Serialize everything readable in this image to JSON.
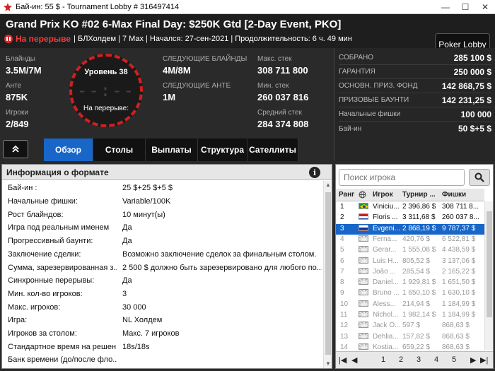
{
  "window": {
    "title": "Бай-ин: 55 $ - Tournament Lobby # 316497414"
  },
  "header": {
    "tournament_title": "Grand Prix KO #02 6-Max Final Day: $250K Gtd [2-Day Event, PKO]",
    "status": "На перерыве",
    "details": "| БЛХолдем | 7 Max | Начался: 27-сен-2021 | Продолжительность: 6 ч. 49 мин",
    "lobby_button": "Poker Lobby"
  },
  "info": {
    "blinds_label": "Блайнды",
    "blinds_value": "3.5M/7M",
    "ante_label": "Анте",
    "ante_value": "875K",
    "players_label": "Игроки",
    "players_value": "2/849",
    "level_label": "Уровень 38",
    "clock_value": "--:--",
    "break_label": "На перерыве:",
    "next_blinds_label": "СЛЕДУЮЩИЕ БЛАЙНДЫ",
    "next_blinds_value": "4M/8M",
    "next_ante_label": "СЛЕДУЮЩИЕ АНТЕ",
    "next_ante_value": "1M",
    "max_stack_label": "Макс. стек",
    "max_stack_value": "308 711 800",
    "min_stack_label": "Мин. стек",
    "min_stack_value": "260 037 816",
    "avg_stack_label": "Средний стек",
    "avg_stack_value": "284 374 808"
  },
  "stats": [
    {
      "label": "СОБРАНО",
      "value": "285 100 $"
    },
    {
      "label": "ГАРАНТИЯ",
      "value": "250 000 $"
    },
    {
      "label": "ОСНОВН. ПРИЗ. ФОНД",
      "value": "142 868,75 $"
    },
    {
      "label": "ПРИЗОВЫЕ БАУНТИ",
      "value": "142 231,25 $"
    },
    {
      "label": "Начальные фишки",
      "value": "100 000"
    },
    {
      "label": "Бай-ин",
      "value": "50 $+5 $"
    }
  ],
  "tabs": [
    "Обзор",
    "Столы",
    "Выплаты",
    "Структура",
    "Сателлиты"
  ],
  "format_panel": {
    "title": "Информация о формате",
    "rows": [
      {
        "k": "Бай-ин :",
        "v": "25 $+25 $+5 $"
      },
      {
        "k": "Начальные фишки:",
        "v": "Variable/100K"
      },
      {
        "k": "Рост блайндов:",
        "v": "10 минут(ы)"
      },
      {
        "k": "Игра под реальным именем",
        "v": "Да"
      },
      {
        "k": "Прогрессивный баунти:",
        "v": "Да"
      },
      {
        "k": "Заключение сделки:",
        "v": "Возможно заключение сделок за финальным столом."
      },
      {
        "k": "Сумма, зарезервированная з...",
        "v": "2 500 $ должно быть зарезервировано для любого по..."
      },
      {
        "k": "Синхронные перерывы:",
        "v": "Да"
      },
      {
        "k": "Мин. кол-во игроков:",
        "v": "3"
      },
      {
        "k": "Макс. игроков:",
        "v": "30 000"
      },
      {
        "k": "Игра:",
        "v": "NL Холдем"
      },
      {
        "k": "Игроков за столом:",
        "v": "Макс. 7 игроков"
      },
      {
        "k": "Стандартное время на решен...",
        "v": "18s/18s"
      },
      {
        "k": "Банк времени (до/после фло...",
        "v": ""
      }
    ]
  },
  "players_panel": {
    "search_placeholder": "Поиск игрока",
    "columns": {
      "rank": "Ранг",
      "name": "Игрок",
      "tour": "Турнир ...",
      "chips": "Фишки"
    },
    "rows": [
      {
        "rank": "1",
        "name": "Viniciu...",
        "tour": "2 396,86 $",
        "chips": "308 711 8...",
        "flag": "br",
        "state": "top"
      },
      {
        "rank": "2",
        "name": "Floris ...",
        "tour": "3 311,68 $",
        "chips": "260 037 8...",
        "flag": "nl",
        "state": "top"
      },
      {
        "rank": "3",
        "name": "Evgeni...",
        "tour": "2 868,19 $",
        "chips": "9 787,37 $",
        "flag": "ru",
        "state": "sel"
      },
      {
        "rank": "4",
        "name": "Ferna...",
        "tour": "420,76 $",
        "chips": "6 522,81 $",
        "flag": "gb",
        "state": "dim"
      },
      {
        "rank": "5",
        "name": "Gerar...",
        "tour": "1 555,08 $",
        "chips": "4 438,59 $",
        "flag": "gb",
        "state": "dim"
      },
      {
        "rank": "6",
        "name": "Luis H...",
        "tour": "805,52 $",
        "chips": "3 137,06 $",
        "flag": "gb",
        "state": "dim"
      },
      {
        "rank": "7",
        "name": "João ...",
        "tour": "285,54 $",
        "chips": "2 165,22 $",
        "flag": "gb",
        "state": "dim"
      },
      {
        "rank": "8",
        "name": "Daniel...",
        "tour": "1 929,81 $",
        "chips": "1 651,50 $",
        "flag": "gb",
        "state": "dim"
      },
      {
        "rank": "9",
        "name": "Bruno ...",
        "tour": "1 650,10 $",
        "chips": "1 630,10 $",
        "flag": "gb",
        "state": "dim"
      },
      {
        "rank": "10",
        "name": "Aless...",
        "tour": "214,94 $",
        "chips": "1 184,99 $",
        "flag": "gb",
        "state": "dim"
      },
      {
        "rank": "11",
        "name": "Nichol...",
        "tour": "1 982,14 $",
        "chips": "1 184,99 $",
        "flag": "gb",
        "state": "dim"
      },
      {
        "rank": "12",
        "name": "Jack O...",
        "tour": "597 $",
        "chips": "868,63 $",
        "flag": "gb",
        "state": "dim"
      },
      {
        "rank": "13",
        "name": "Dehlia...",
        "tour": "157,82 $",
        "chips": "868,63 $",
        "flag": "gb",
        "state": "dim"
      },
      {
        "rank": "14",
        "name": "Kostia...",
        "tour": "659,22 $",
        "chips": "868,63 $",
        "flag": "gb",
        "state": "dim"
      }
    ],
    "pages": [
      "1",
      "2",
      "3",
      "4",
      "5"
    ]
  }
}
